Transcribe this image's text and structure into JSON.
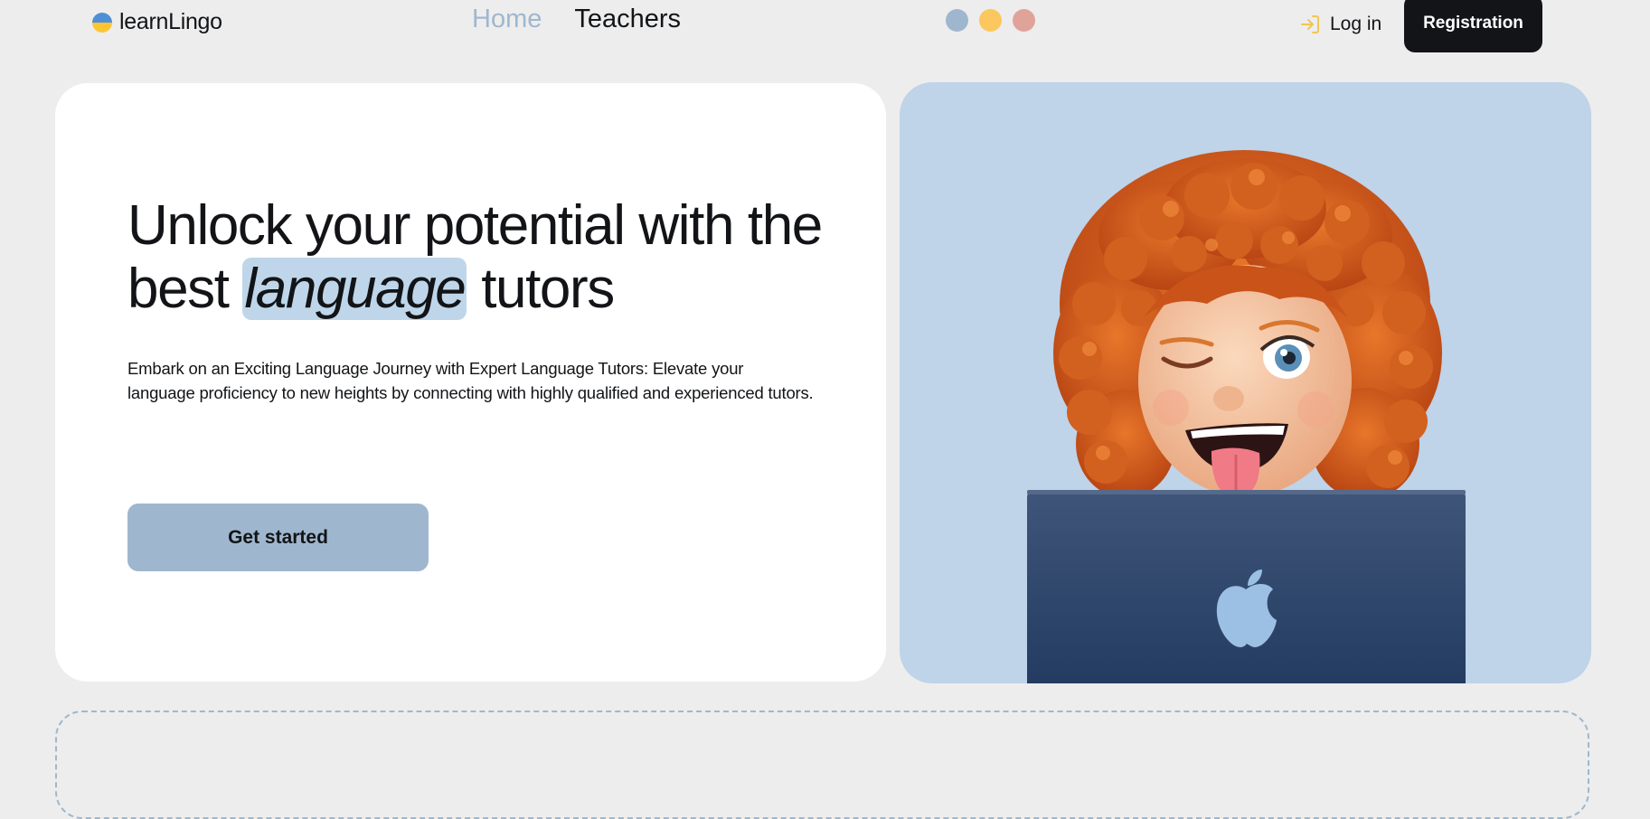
{
  "header": {
    "logo_text": "learnLingo",
    "nav": [
      {
        "label": "Home",
        "active": true
      },
      {
        "label": "Teachers",
        "active": false
      }
    ],
    "theme_colors": [
      "#9fb7ce",
      "#fbc75e",
      "#e0a39a"
    ],
    "login_label": "Log in",
    "registration_label": "Registration"
  },
  "hero": {
    "title_before": "Unlock your potential with the best ",
    "title_highlight": "language",
    "title_after": " tutors",
    "description": "Embark on an Exciting Language Journey with Expert Language Tutors: Elevate your language proficiency to new heights by connecting with highly qualified and experienced tutors.",
    "cta_label": "Get started"
  },
  "colors": {
    "accent": "#9fb7ce",
    "highlight": "#bfd6ea",
    "dark": "#121417",
    "image_bg": "#bfd3e9"
  },
  "illustration": {
    "subject": "memoji-girl-with-laptop",
    "laptop_logo": "apple-logo-icon"
  }
}
